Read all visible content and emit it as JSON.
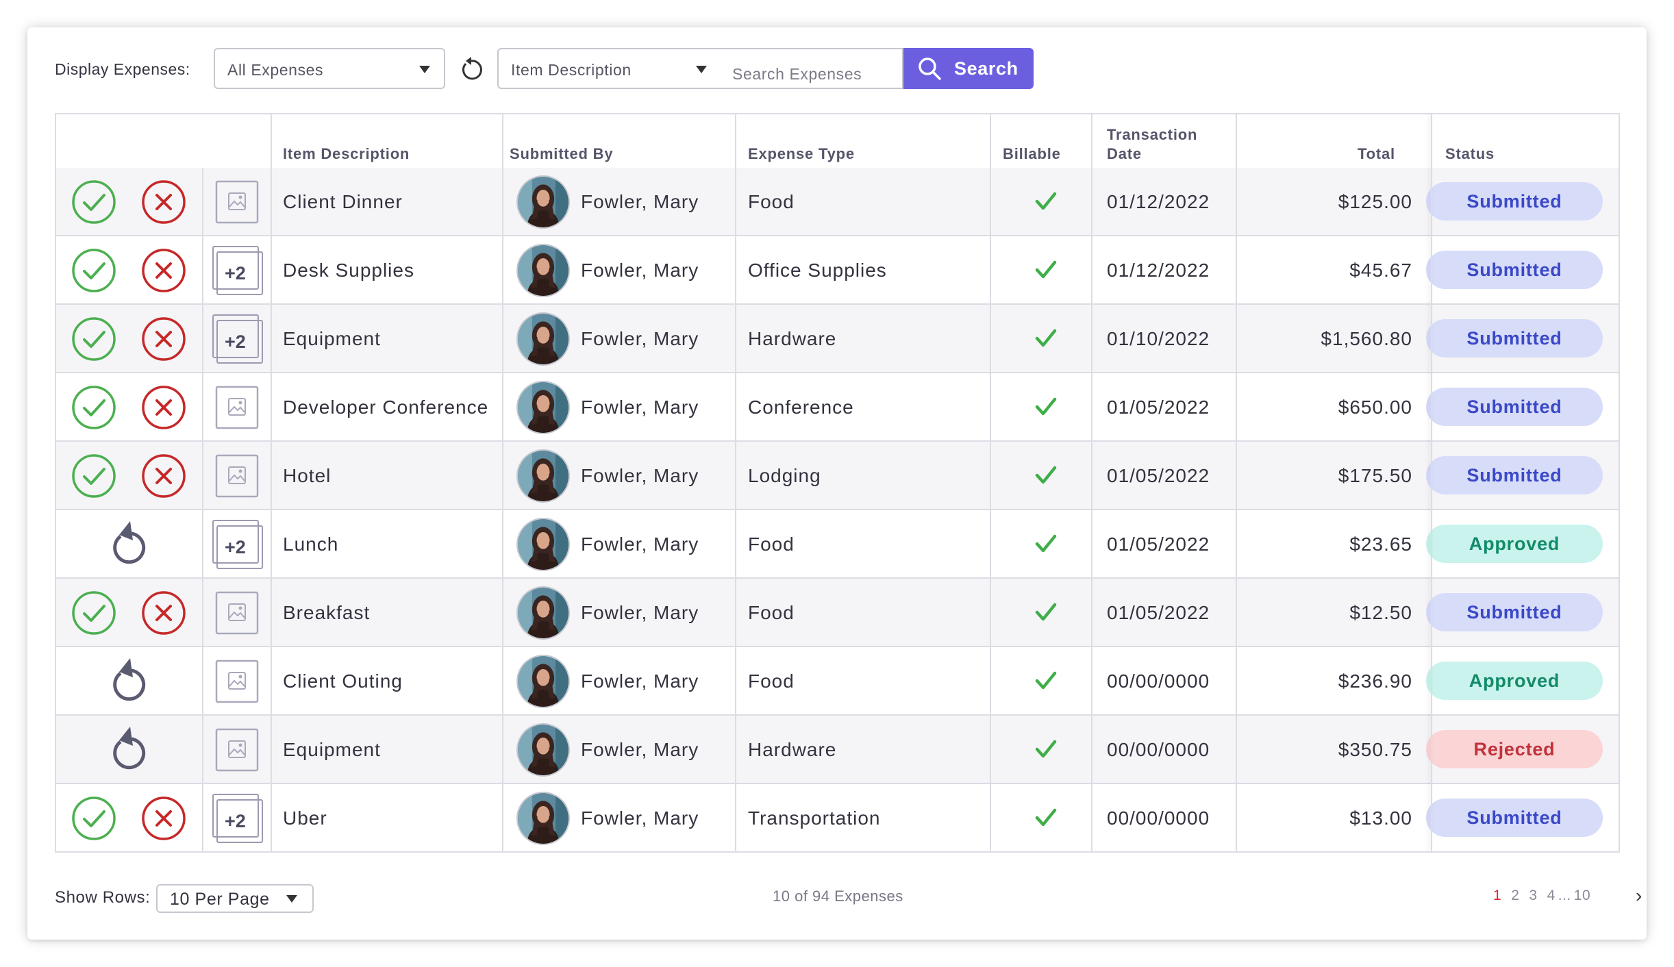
{
  "toolbar": {
    "display_label": "Display Expenses:",
    "display_value": "All Expenses",
    "field_value": "Item Description",
    "search_placeholder": "Search Expenses",
    "search_button": "Search"
  },
  "columns": {
    "item": "Item Description",
    "submitted_by": "Submitted By",
    "expense_type": "Expense Type",
    "billable": "Billable",
    "transaction_date_1": "Transaction",
    "transaction_date_2": "Date",
    "total": "Total",
    "status": "Status"
  },
  "rows": [
    {
      "item": "Client Dinner",
      "submitted_by": "Fowler, Mary",
      "type": "Food",
      "billable": true,
      "date": "01/12/2022",
      "total": "$125.00",
      "status": "Submitted",
      "actions": "approve-reject",
      "receipt": "image"
    },
    {
      "item": "Desk Supplies",
      "submitted_by": "Fowler, Mary",
      "type": "Office Supplies",
      "billable": true,
      "date": "01/12/2022",
      "total": "$45.67",
      "status": "Submitted",
      "actions": "approve-reject",
      "receipt": "+2"
    },
    {
      "item": "Equipment",
      "submitted_by": "Fowler, Mary",
      "type": "Hardware",
      "billable": true,
      "date": "01/10/2022",
      "total": "$1,560.80",
      "status": "Submitted",
      "actions": "approve-reject",
      "receipt": "+2"
    },
    {
      "item": "Developer Conference",
      "submitted_by": "Fowler, Mary",
      "type": "Conference",
      "billable": true,
      "date": "01/05/2022",
      "total": "$650.00",
      "status": "Submitted",
      "actions": "approve-reject",
      "receipt": "image"
    },
    {
      "item": "Hotel",
      "submitted_by": "Fowler, Mary",
      "type": "Lodging",
      "billable": true,
      "date": "01/05/2022",
      "total": "$175.50",
      "status": "Submitted",
      "actions": "approve-reject",
      "receipt": "image"
    },
    {
      "item": "Lunch",
      "submitted_by": "Fowler, Mary",
      "type": "Food",
      "billable": true,
      "date": "01/05/2022",
      "total": "$23.65",
      "status": "Approved",
      "actions": "undo",
      "receipt": "+2"
    },
    {
      "item": "Breakfast",
      "submitted_by": "Fowler, Mary",
      "type": "Food",
      "billable": true,
      "date": "01/05/2022",
      "total": "$12.50",
      "status": "Submitted",
      "actions": "approve-reject",
      "receipt": "image"
    },
    {
      "item": "Client Outing",
      "submitted_by": "Fowler, Mary",
      "type": "Food",
      "billable": true,
      "date": "00/00/0000",
      "total": "$236.90",
      "status": "Approved",
      "actions": "undo",
      "receipt": "image"
    },
    {
      "item": "Equipment",
      "submitted_by": "Fowler, Mary",
      "type": "Hardware",
      "billable": true,
      "date": "00/00/0000",
      "total": "$350.75",
      "status": "Rejected",
      "actions": "undo",
      "receipt": "image"
    },
    {
      "item": "Uber",
      "submitted_by": "Fowler, Mary",
      "type": "Transportation",
      "billable": true,
      "date": "00/00/0000",
      "total": "$13.00",
      "status": "Submitted",
      "actions": "approve-reject",
      "receipt": "+2"
    }
  ],
  "footer": {
    "show_rows_label": "Show Rows:",
    "rows_value": "10 Per Page",
    "count_text": "10 of 94 Expenses",
    "pages": [
      "1",
      "2",
      "3",
      "4",
      "...",
      "10"
    ],
    "active_page": "1",
    "next_icon": "chevron-right-icon"
  },
  "colors": {
    "accent": "#6b5fe0",
    "approve": "#4caf50",
    "reject": "#c62828",
    "submitted_bg": "#d7dcf9",
    "approved_bg": "#c9f3ec",
    "rejected_bg": "#fbd4d6"
  }
}
